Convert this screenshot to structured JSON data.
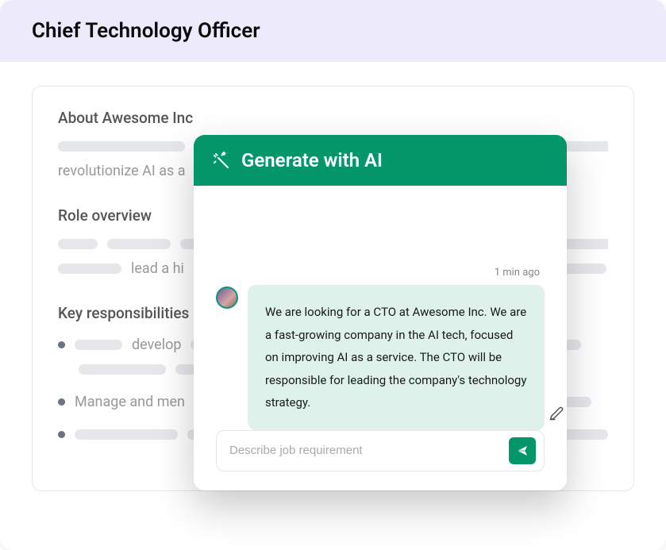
{
  "page_title": "Chief Technology Officer",
  "sections": {
    "about": {
      "heading": "About Awesome Inc",
      "partial_text": "revolutionize AI as a"
    },
    "role": {
      "heading": "Role overview",
      "partial_text": "lead a hi"
    },
    "responsibilities": {
      "heading": "Key responsibilities",
      "bullet1_text": "develop",
      "bullet2_text": "Manage and men"
    }
  },
  "ai_modal": {
    "title": "Generate with AI",
    "timestamp": "1 min ago",
    "message": "We are looking for a CTO at Awesome Inc. We are a fast-growing company in the AI tech, focused on improving AI as a service. The CTO will be responsible for leading the company's technology strategy.",
    "input_placeholder": "Describe job requirement"
  },
  "colors": {
    "accent": "#049669",
    "header_bg": "#EDEAFC",
    "bubble_bg": "#DEF2EB"
  }
}
